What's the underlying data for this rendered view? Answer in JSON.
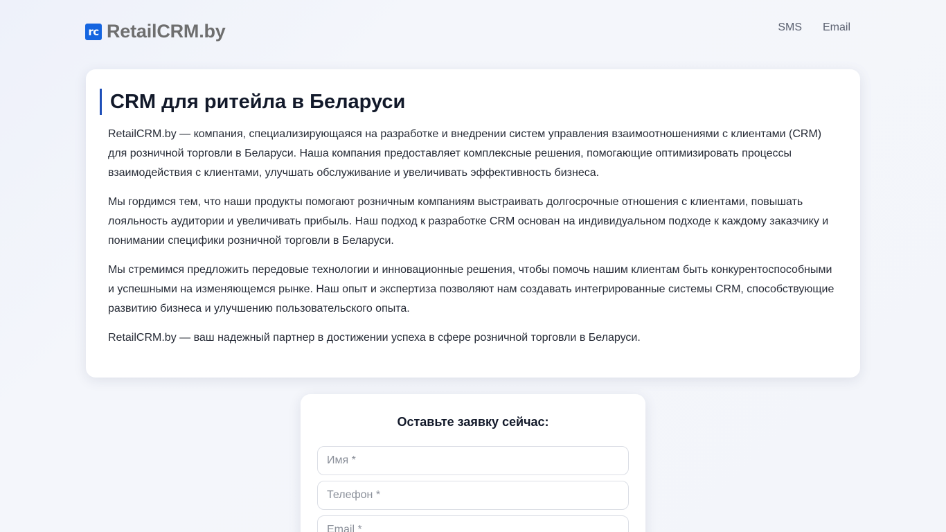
{
  "header": {
    "logo_badge": "rc",
    "logo_text": "RetailCRM.by",
    "nav": [
      {
        "label": "SMS"
      },
      {
        "label": "Email"
      }
    ]
  },
  "main": {
    "title": "CRM для ритейла в Беларуси",
    "paragraphs": [
      "RetailCRM.by — компания, специализирующаяся на разработке и внедрении систем управления взаимоотношениями с клиентами (CRM) для розничной торговли в Беларуси. Наша компания предоставляет комплексные решения, помогающие оптимизировать процессы взаимодействия с клиентами, улучшать обслуживание и увеличивать эффективность бизнеса.",
      "Мы гордимся тем, что наши продукты помогают розничным компаниям выстраивать долгосрочные отношения с клиентами, повышать лояльность аудитории и увеличивать прибыль. Наш подход к разработке CRM основан на индивидуальном подходе к каждому заказчику и понимании специфики розничной торговли в Беларуси.",
      "Мы стремимся предложить передовые технологии и инновационные решения, чтобы помочь нашим клиентам быть конкурентоспособными и успешными на изменяющемся рынке. Наш опыт и экспертиза позволяют нам создавать интегрированные системы CRM, способствующие развитию бизнеса и улучшению пользовательского опыта.",
      "RetailCRM.by — ваш надежный партнер в достижении успеха в сфере розничной торговли в Беларуси."
    ]
  },
  "form": {
    "title": "Оставьте заявку сейчас:",
    "name_placeholder": "Имя *",
    "name_value": "",
    "phone_placeholder": "Телефон *",
    "phone_value": "",
    "email_placeholder": "Email *",
    "email_value": ""
  },
  "colors": {
    "accent": "#1565e0",
    "title_border": "#1e4fb8",
    "background": "#f3f5fa"
  }
}
